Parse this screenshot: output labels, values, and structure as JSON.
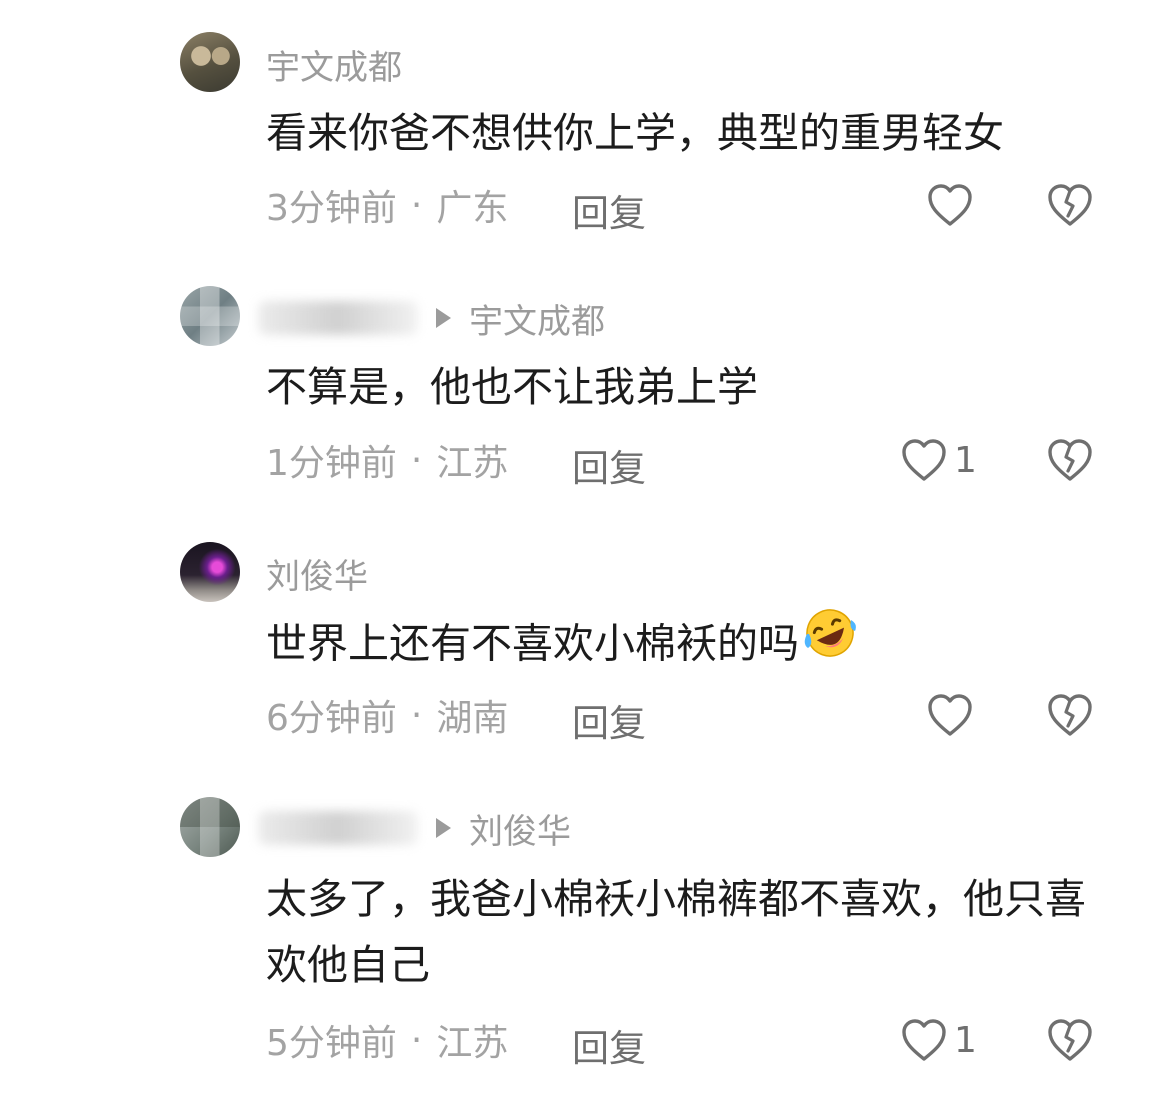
{
  "comments": [
    {
      "username": "宇文成都",
      "reply_to": "",
      "text": "看来你爸不想供你上学，典型的重男轻女",
      "time": "3分钟前",
      "location": "广东",
      "reply_label": "回复",
      "likes": ""
    },
    {
      "username": "",
      "reply_to": "宇文成都",
      "text": "不算是，他也不让我弟上学",
      "time": "1分钟前",
      "location": "江苏",
      "reply_label": "回复",
      "likes": "1"
    },
    {
      "username": "刘俊华",
      "reply_to": "",
      "text": "世界上还有不喜欢小棉袄的吗",
      "time": "6分钟前",
      "location": "湖南",
      "reply_label": "回复",
      "likes": ""
    },
    {
      "username": "",
      "reply_to": "刘俊华",
      "text": "太多了，我爸小棉袄小棉裤都不喜欢，他只喜欢他自己",
      "time": "5分钟前",
      "location": "江苏",
      "reply_label": "回复",
      "likes": "1"
    }
  ],
  "meta_separator": "·",
  "icons": {
    "like": "heart-outline-icon",
    "dislike": "broken-heart-icon",
    "reply_indicator": "triangle-right-icon",
    "emoji": "rofl-crying-laughing-emoji"
  },
  "colors": {
    "background": "#ffffff",
    "username": "#9b9b9b",
    "text": "#1c1c1c",
    "meta": "#a3a3a3",
    "action": "#6f6f6f"
  }
}
